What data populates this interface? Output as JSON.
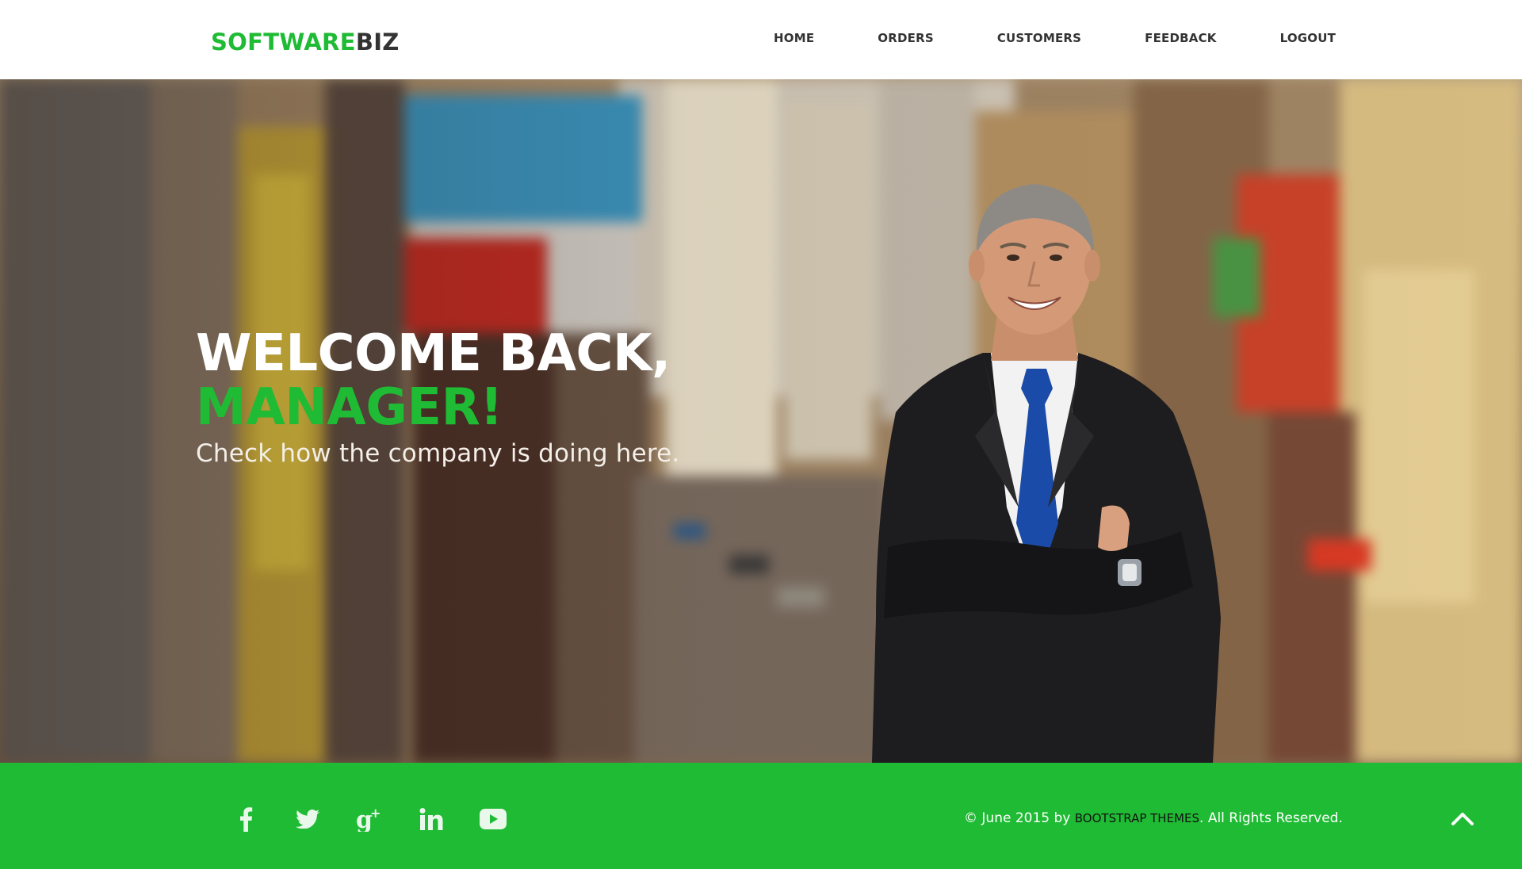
{
  "header": {
    "logo_part1": "SOFTWARE",
    "logo_part2": "BIZ",
    "nav": [
      {
        "label": "HOME"
      },
      {
        "label": "ORDERS"
      },
      {
        "label": "CUSTOMERS"
      },
      {
        "label": "FEEDBACK"
      },
      {
        "label": "LOGOUT"
      }
    ]
  },
  "hero": {
    "line1": "WELCOME BACK,",
    "line2": "MANAGER!",
    "subtitle": "Check how the company is doing here."
  },
  "footer": {
    "social_icons": [
      "facebook-icon",
      "twitter-icon",
      "google-plus-icon",
      "linkedin-icon",
      "youtube-icon"
    ],
    "copyright_prefix": "© June 2015 by ",
    "copyright_link": "BOOTSTRAP THEMES",
    "copyright_suffix": ". All Rights Reserved."
  },
  "colors": {
    "brand_green": "#1fbb34",
    "dark_text": "#333333"
  }
}
